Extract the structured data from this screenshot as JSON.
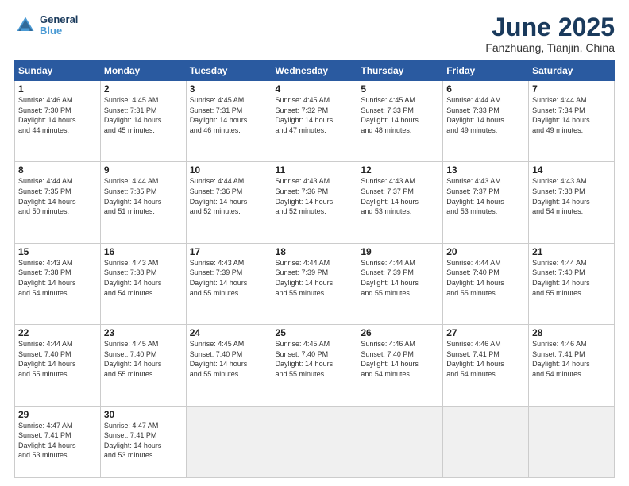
{
  "logo": {
    "line1": "General",
    "line2": "Blue"
  },
  "title": "June 2025",
  "subtitle": "Fanzhuang, Tianjin, China",
  "days_header": [
    "Sunday",
    "Monday",
    "Tuesday",
    "Wednesday",
    "Thursday",
    "Friday",
    "Saturday"
  ],
  "weeks": [
    [
      {
        "num": "1",
        "info": "Sunrise: 4:46 AM\nSunset: 7:30 PM\nDaylight: 14 hours\nand 44 minutes."
      },
      {
        "num": "2",
        "info": "Sunrise: 4:45 AM\nSunset: 7:31 PM\nDaylight: 14 hours\nand 45 minutes."
      },
      {
        "num": "3",
        "info": "Sunrise: 4:45 AM\nSunset: 7:31 PM\nDaylight: 14 hours\nand 46 minutes."
      },
      {
        "num": "4",
        "info": "Sunrise: 4:45 AM\nSunset: 7:32 PM\nDaylight: 14 hours\nand 47 minutes."
      },
      {
        "num": "5",
        "info": "Sunrise: 4:45 AM\nSunset: 7:33 PM\nDaylight: 14 hours\nand 48 minutes."
      },
      {
        "num": "6",
        "info": "Sunrise: 4:44 AM\nSunset: 7:33 PM\nDaylight: 14 hours\nand 49 minutes."
      },
      {
        "num": "7",
        "info": "Sunrise: 4:44 AM\nSunset: 7:34 PM\nDaylight: 14 hours\nand 49 minutes."
      }
    ],
    [
      {
        "num": "8",
        "info": "Sunrise: 4:44 AM\nSunset: 7:35 PM\nDaylight: 14 hours\nand 50 minutes."
      },
      {
        "num": "9",
        "info": "Sunrise: 4:44 AM\nSunset: 7:35 PM\nDaylight: 14 hours\nand 51 minutes."
      },
      {
        "num": "10",
        "info": "Sunrise: 4:44 AM\nSunset: 7:36 PM\nDaylight: 14 hours\nand 52 minutes."
      },
      {
        "num": "11",
        "info": "Sunrise: 4:43 AM\nSunset: 7:36 PM\nDaylight: 14 hours\nand 52 minutes."
      },
      {
        "num": "12",
        "info": "Sunrise: 4:43 AM\nSunset: 7:37 PM\nDaylight: 14 hours\nand 53 minutes."
      },
      {
        "num": "13",
        "info": "Sunrise: 4:43 AM\nSunset: 7:37 PM\nDaylight: 14 hours\nand 53 minutes."
      },
      {
        "num": "14",
        "info": "Sunrise: 4:43 AM\nSunset: 7:38 PM\nDaylight: 14 hours\nand 54 minutes."
      }
    ],
    [
      {
        "num": "15",
        "info": "Sunrise: 4:43 AM\nSunset: 7:38 PM\nDaylight: 14 hours\nand 54 minutes."
      },
      {
        "num": "16",
        "info": "Sunrise: 4:43 AM\nSunset: 7:38 PM\nDaylight: 14 hours\nand 54 minutes."
      },
      {
        "num": "17",
        "info": "Sunrise: 4:43 AM\nSunset: 7:39 PM\nDaylight: 14 hours\nand 55 minutes."
      },
      {
        "num": "18",
        "info": "Sunrise: 4:44 AM\nSunset: 7:39 PM\nDaylight: 14 hours\nand 55 minutes."
      },
      {
        "num": "19",
        "info": "Sunrise: 4:44 AM\nSunset: 7:39 PM\nDaylight: 14 hours\nand 55 minutes."
      },
      {
        "num": "20",
        "info": "Sunrise: 4:44 AM\nSunset: 7:40 PM\nDaylight: 14 hours\nand 55 minutes."
      },
      {
        "num": "21",
        "info": "Sunrise: 4:44 AM\nSunset: 7:40 PM\nDaylight: 14 hours\nand 55 minutes."
      }
    ],
    [
      {
        "num": "22",
        "info": "Sunrise: 4:44 AM\nSunset: 7:40 PM\nDaylight: 14 hours\nand 55 minutes."
      },
      {
        "num": "23",
        "info": "Sunrise: 4:45 AM\nSunset: 7:40 PM\nDaylight: 14 hours\nand 55 minutes."
      },
      {
        "num": "24",
        "info": "Sunrise: 4:45 AM\nSunset: 7:40 PM\nDaylight: 14 hours\nand 55 minutes."
      },
      {
        "num": "25",
        "info": "Sunrise: 4:45 AM\nSunset: 7:40 PM\nDaylight: 14 hours\nand 55 minutes."
      },
      {
        "num": "26",
        "info": "Sunrise: 4:46 AM\nSunset: 7:40 PM\nDaylight: 14 hours\nand 54 minutes."
      },
      {
        "num": "27",
        "info": "Sunrise: 4:46 AM\nSunset: 7:41 PM\nDaylight: 14 hours\nand 54 minutes."
      },
      {
        "num": "28",
        "info": "Sunrise: 4:46 AM\nSunset: 7:41 PM\nDaylight: 14 hours\nand 54 minutes."
      }
    ],
    [
      {
        "num": "29",
        "info": "Sunrise: 4:47 AM\nSunset: 7:41 PM\nDaylight: 14 hours\nand 53 minutes."
      },
      {
        "num": "30",
        "info": "Sunrise: 4:47 AM\nSunset: 7:41 PM\nDaylight: 14 hours\nand 53 minutes."
      },
      {
        "num": "",
        "info": ""
      },
      {
        "num": "",
        "info": ""
      },
      {
        "num": "",
        "info": ""
      },
      {
        "num": "",
        "info": ""
      },
      {
        "num": "",
        "info": ""
      }
    ]
  ]
}
